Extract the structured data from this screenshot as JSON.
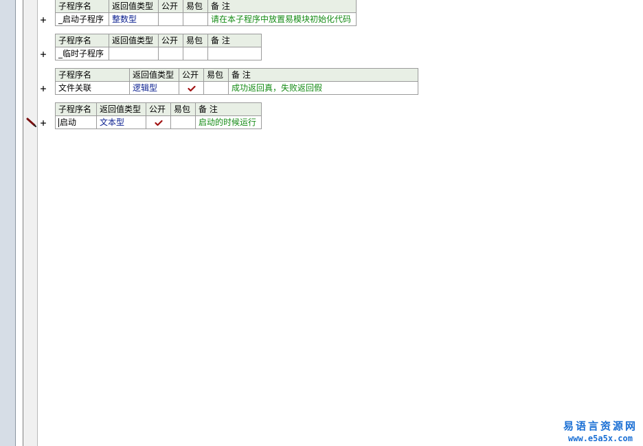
{
  "headers": {
    "name": "子程序名",
    "return_type": "返回值类型",
    "public": "公开",
    "epack": "易包",
    "note": "备 注"
  },
  "subroutines": [
    {
      "name": "_启动子程序",
      "return_type": "整数型",
      "public": false,
      "epack": false,
      "note": "请在本子程序中放置易模块初始化代码"
    },
    {
      "name": "_临时子程序",
      "return_type": "",
      "public": false,
      "epack": false,
      "note": ""
    },
    {
      "name": "文件关联",
      "return_type": "逻辑型",
      "public": true,
      "epack": false,
      "note": "成功返回真，失败返回假"
    },
    {
      "name": "启动",
      "return_type": "文本型",
      "public": true,
      "epack": false,
      "note": "启动的时候运行"
    }
  ],
  "expander_symbol": "+",
  "watermark": {
    "text": "易语言资源网",
    "url": "www.e5a5x.com"
  },
  "icons": {
    "current_line": "pencil-icon",
    "checked": "check-icon"
  },
  "colors": {
    "header_bg": "#e8efe5",
    "return_type": "#0a1f8f",
    "note": "#138a13",
    "check": "#a01010",
    "watermark": "#1a6fd4"
  }
}
